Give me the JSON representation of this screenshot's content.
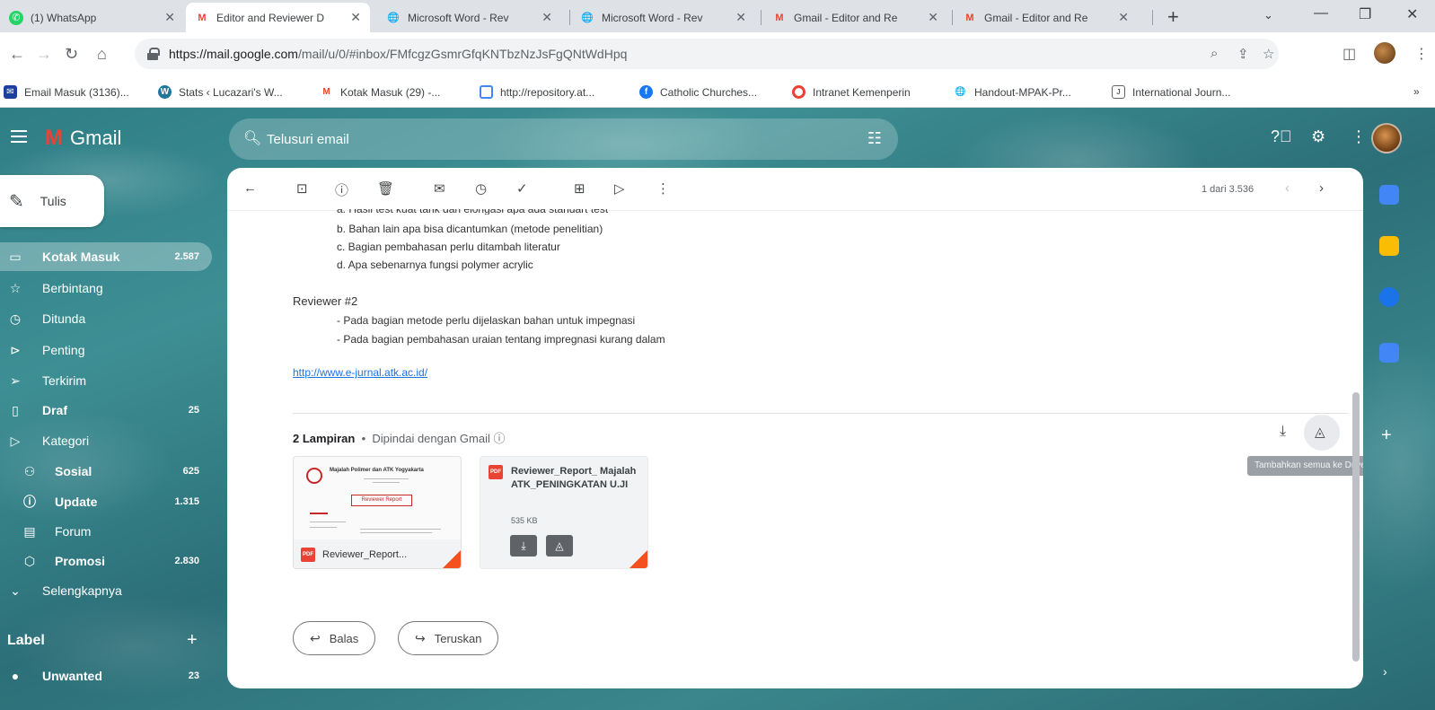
{
  "browser": {
    "tabs": [
      {
        "title": "(1) WhatsApp",
        "favicon": "whatsapp-icon"
      },
      {
        "title": "Editor and Reviewer D",
        "favicon": "gmail-icon"
      },
      {
        "title": "Microsoft Word - Rev",
        "favicon": "globe-icon"
      },
      {
        "title": "Microsoft Word - Rev",
        "favicon": "globe-icon"
      },
      {
        "title": "Gmail - Editor and Re",
        "favicon": "gmail-icon"
      },
      {
        "title": "Gmail - Editor and Re",
        "favicon": "gmail-icon"
      }
    ],
    "url_host": "https://mail.google.com",
    "url_path": "/mail/u/0/#inbox/FMfcgzGsmrGfqKNTbzNzJsFgQNtWdHpq",
    "bookmarks": [
      "Email Masuk (3136)...",
      "Stats ‹ Lucazari's W...",
      "Kotak Masuk (29) -...",
      "http://repository.at...",
      "Catholic Churches...",
      "Intranet Kemenperin",
      "Handout-MPAK-Pr...",
      "International Journ..."
    ]
  },
  "gmail": {
    "brand": "Gmail",
    "search_placeholder": "Telusuri email",
    "compose_label": "Tulis",
    "nav": [
      {
        "label": "Kotak Masuk",
        "count": "2.587",
        "icon": "inbox-icon",
        "active": true
      },
      {
        "label": "Berbintang",
        "count": "",
        "icon": "star-icon"
      },
      {
        "label": "Ditunda",
        "count": "",
        "icon": "clock-icon"
      },
      {
        "label": "Penting",
        "count": "",
        "icon": "important-icon"
      },
      {
        "label": "Terkirim",
        "count": "",
        "icon": "send-icon"
      },
      {
        "label": "Draf",
        "count": "25",
        "icon": "draft-icon",
        "bold": true
      },
      {
        "label": "Kategori",
        "count": "",
        "icon": "label-icon"
      },
      {
        "label": "Sosial",
        "count": "625",
        "icon": "people-icon",
        "sub": true,
        "bold": true
      },
      {
        "label": "Update",
        "count": "1.315",
        "icon": "info-icon",
        "sub": true,
        "bold": true
      },
      {
        "label": "Forum",
        "count": "",
        "icon": "forum-icon",
        "sub": true
      },
      {
        "label": "Promosi",
        "count": "2.830",
        "icon": "tag-icon",
        "sub": true,
        "bold": true
      },
      {
        "label": "Selengkapnya",
        "count": "",
        "icon": "chevron-down-icon"
      }
    ],
    "label_header": "Label",
    "labels": [
      {
        "label": "Unwanted",
        "count": "23"
      }
    ],
    "message_counter": "1 dari 3.536",
    "body": {
      "cut_line": "a. Hasil test kuat tarik dan elongasi apa ada standart test",
      "r1_items": [
        "b. Bahan lain apa bisa dicantumkan (metode penelitian)",
        "c. Bagian pembahasan perlu ditambah literatur",
        "d. Apa sebenarnya fungsi polymer acrylic"
      ],
      "reviewer2_title": "Reviewer #2",
      "r2_items": [
        "- Pada bagian metode perlu dijelaskan bahan untuk impegnasi",
        "- Pada bagian pembahasan uraian tentang impregnasi kurang dalam"
      ],
      "link": "http://www.e-jurnal.atk.ac.id/"
    },
    "attachments": {
      "count_label": "2 Lampiran",
      "scan_note": "Dipindai dengan Gmail",
      "tooltip": "Tambahkan semua ke Drive",
      "items": [
        {
          "name": "Reviewer_Report...",
          "thumb_title": "Majalah Polimer dan ATK Yogyakarta",
          "thumb_sub": "Reviewer Report"
        },
        {
          "name": "Reviewer_Report_ Majalah ATK_PENINGKATAN U.JI",
          "size": "535 KB"
        }
      ]
    },
    "reply_label": "Balas",
    "forward_label": "Teruskan"
  }
}
